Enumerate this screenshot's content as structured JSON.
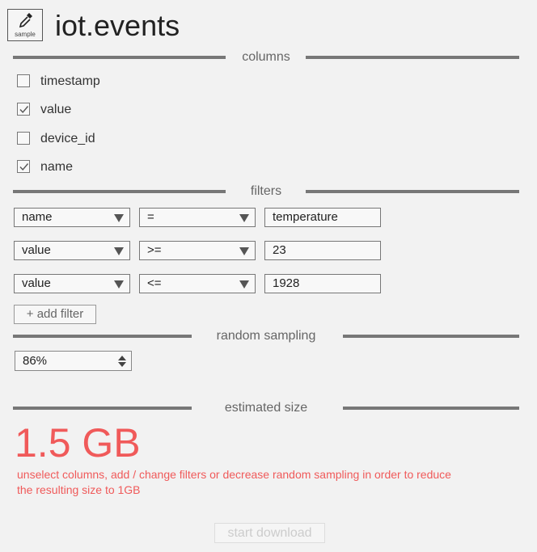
{
  "header": {
    "logo_label": "sample",
    "logo_icon": "eyedropper-icon",
    "title": "iot.events"
  },
  "sections": {
    "columns": "columns",
    "filters": "filters",
    "sampling": "random sampling",
    "size": "estimated size"
  },
  "columns": [
    {
      "label": "timestamp",
      "checked": false
    },
    {
      "label": "value",
      "checked": true
    },
    {
      "label": "device_id",
      "checked": false
    },
    {
      "label": "name",
      "checked": true
    }
  ],
  "filters": [
    {
      "field": "name",
      "operator": "=",
      "value": "temperature"
    },
    {
      "field": "value",
      "operator": ">=",
      "value": "23"
    },
    {
      "field": "value",
      "operator": "<=",
      "value": "1928"
    }
  ],
  "add_filter_label": "+ add filter",
  "sampling_value": "86%",
  "estimated_size": "1.5 GB",
  "warning": "unselect columns, add / change filters or decrease random sampling in order to reduce the resulting size to 1GB",
  "download_label": "start download",
  "colors": {
    "warning": "#f05a5a",
    "divider": "#777777"
  }
}
